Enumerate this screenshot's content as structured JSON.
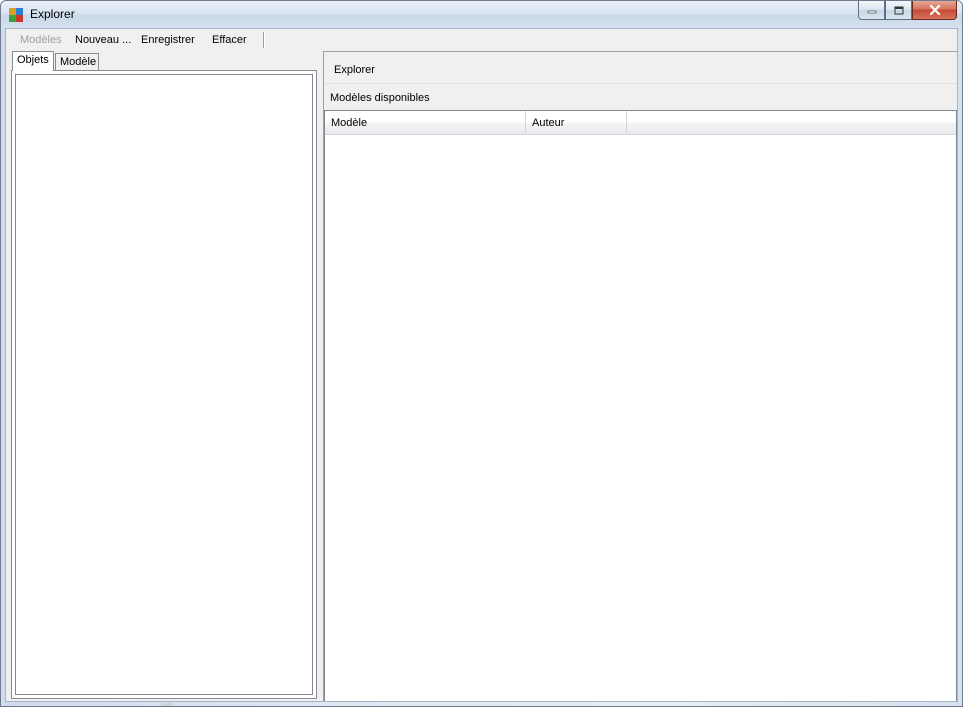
{
  "window": {
    "title": "Explorer"
  },
  "menu": {
    "items": [
      {
        "label": "Modèles",
        "disabled": true
      },
      {
        "label": "Nouveau ...",
        "disabled": false
      },
      {
        "label": "Enregistrer",
        "disabled": false
      },
      {
        "label": "Effacer",
        "disabled": false
      }
    ]
  },
  "left_tabs": {
    "tabs": [
      {
        "label": "Objets",
        "selected": true
      },
      {
        "label": "Modèle",
        "selected": false
      }
    ]
  },
  "right_panel": {
    "header": "Explorer",
    "subheader": "Modèles disponibles",
    "list_columns": [
      "Modèle",
      "Auteur"
    ],
    "rows": []
  },
  "icons": {
    "app": "app-icon",
    "minimize": "minimize-icon",
    "maximize": "maximize-icon",
    "close": "close-icon"
  },
  "colors": {
    "client_bg": "#f0f0f0",
    "close_button": "#c44a33",
    "disabled_text": "#a0a0a0"
  }
}
